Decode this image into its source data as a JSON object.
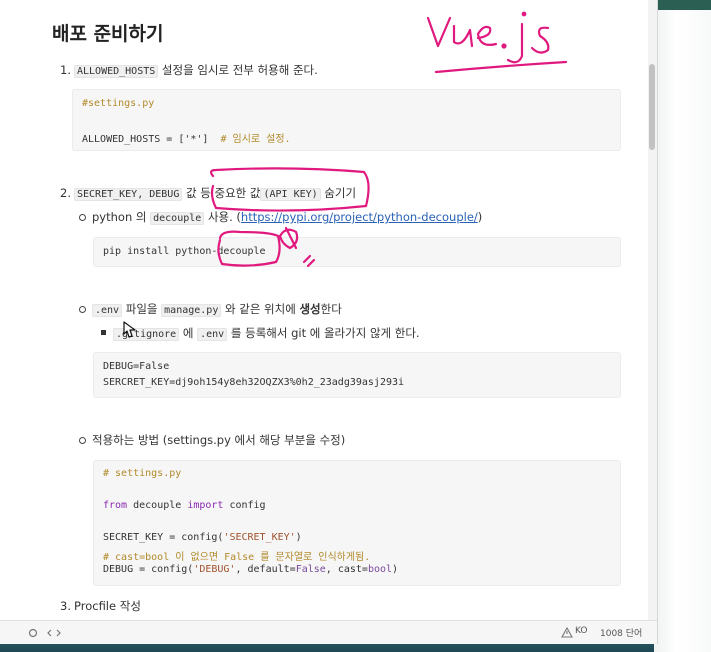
{
  "doc": {
    "title": "배포 준비하기",
    "s1": {
      "num": "1.",
      "code": "ALLOWED_HOSTS",
      "text": " 설정을 임시로 전부 허용해 준다."
    },
    "block1": {
      "l1": "#settings.py",
      "l2a": "ALLOWED_HOSTS = ['*']",
      "l2b": "  # 임시로 설정."
    },
    "s2": {
      "num": "2.",
      "code": "SECRET_KEY, DEBUG",
      "t1": " 값 등 중요한 값",
      "code2": "(API KEY)",
      "t2": " 숨기기"
    },
    "b1": {
      "t1": "python 의 ",
      "code": "decouple",
      "t2": " 사용. (",
      "link": "https://pypi.org/project/python-decouple/",
      "t3": ")"
    },
    "block2": {
      "l1": "pip install python-decouple"
    },
    "b2": {
      "code1": ".env",
      "t1": " 파일을 ",
      "code2": "manage.py",
      "t2": " 와 같은 위치에 ",
      "bold": "생성",
      "t3": "한다"
    },
    "b2sub": {
      "code1": ".gitignore",
      "t1": " 에 ",
      "code2": ".env",
      "t2": " 를 등록해서 git 에 올라가지 않게 한다."
    },
    "block3": {
      "l1": "DEBUG=False",
      "l2": "SERCRET_KEY=dj9oh154y8eh32OQZX3%0h2_23adg39asj293i"
    },
    "b3": {
      "text": "적용하는 방법 (settings.py 에서 해당 부분을 수정)"
    },
    "block4": {
      "l1": "# settings.py",
      "l2a": "from",
      "l2b": " decouple ",
      "l2c": "import",
      "l2d": " config",
      "l3a": "SECRET_KEY = config(",
      "l3b": "'SECRET_KEY'",
      "l3c": ")",
      "l4": "# cast=bool 이 없으면 False 를 문자열로 인식하게됨.",
      "l5a": "DEBUG = config(",
      "l5b": "'DEBUG'",
      "l5c": ", default=",
      "l5d": "False",
      "l5e": ", cast=",
      "l5f": "bool",
      "l5g": ")"
    },
    "s3": {
      "num": "3.",
      "text": "Procfile 작성"
    }
  },
  "annotation": {
    "handwriting": "Vue.js",
    "ink_color": "#e0197f"
  },
  "statusbar": {
    "lang": "KO",
    "words": "1008 단어"
  },
  "icons": {
    "circle": "circle-icon",
    "code": "source-code-icon",
    "warning": "warning-icon"
  }
}
